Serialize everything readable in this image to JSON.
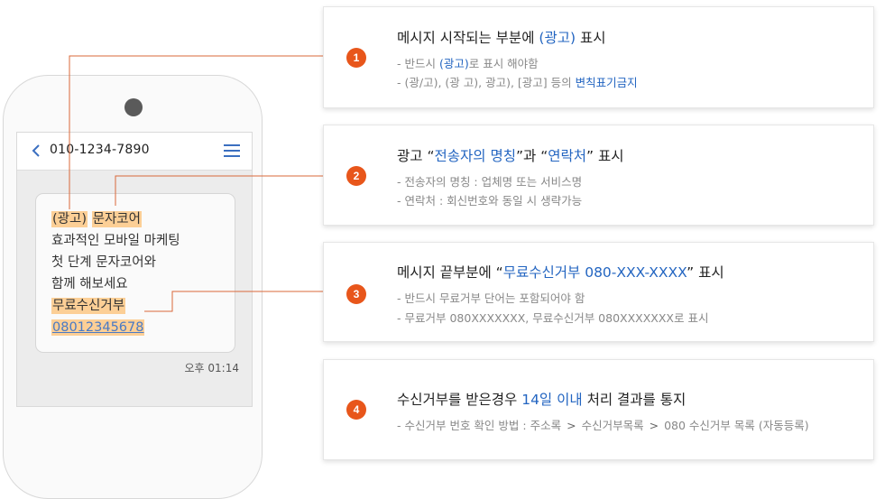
{
  "phone": {
    "number": "010-1234-7890",
    "message": {
      "line1_tag": "(광고)",
      "line1_sender": "문자코어",
      "line2": "효과적인 모바일 마케팅",
      "line3": "첫 단계 문자코어와",
      "line4": "함께 해보세요",
      "optout_label": "무료수신거부",
      "optout_number": "08012345678"
    },
    "time": "오후 01:14"
  },
  "cards": [
    {
      "number": "1",
      "title_pre": "메시지 시작되는 부분에 ",
      "title_hl": "(광고)",
      "title_post": " 표시",
      "line1_pre": "- 반드시 ",
      "line1_hl": "(광고)",
      "line1_post": "로 표시 해야함",
      "line2_pre": "- (광/고), (광 고), 광고), [광고] 등의 ",
      "line2_hl": "변칙표기금지"
    },
    {
      "number": "2",
      "title_pre": "광고 “",
      "title_hl1": "전송자의 명칭",
      "title_mid": "”과 “",
      "title_hl2": "연락처",
      "title_post": "” 표시",
      "line1": "- 전송자의 명칭 : 업체명 또는 서비스명",
      "line2": "- 연락처 : 회신번호와 동일 시 생략가능"
    },
    {
      "number": "3",
      "title_pre": "메시지 끝부분에 “",
      "title_hl": "무료수신거부 080-XXX-XXXX",
      "title_post": "” 표시",
      "line1": "- 반드시 무료거부 단어는 포함되어야 함",
      "line2": "- 무료거부 080XXXXXXX, 무료수신거부 080XXXXXXX로 표시"
    },
    {
      "number": "4",
      "title_pre": "수신거부를 받은경우 ",
      "title_hl": "14일 이내",
      "title_post": " 처리 결과를 통지",
      "line1_a": "- 수신거부 번호 확인 방법 : 주소록",
      "line1_b": "수신거부목록",
      "line1_c": "080 수신거부 목록 (자동등록)"
    }
  ],
  "colors": {
    "badge": "#e8561b",
    "highlight": "#fccf96",
    "accent_blue": "#2365c1",
    "connector": "#d9683a"
  }
}
